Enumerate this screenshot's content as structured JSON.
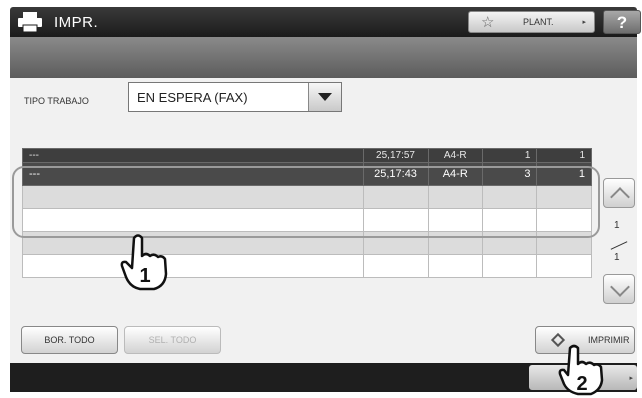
{
  "title": "IMPR.",
  "toolbar": {
    "template_label": "PLANT.",
    "help_label": "?"
  },
  "filter": {
    "label": "TIPO TRABAJO",
    "value": "EN ESPERA (FAX)"
  },
  "jobs": [
    [
      "---",
      "25,17:57",
      "A4-R",
      "1",
      "1"
    ],
    [
      "---",
      "25,17:43",
      "A4-R",
      "3",
      "1"
    ]
  ],
  "pagination": {
    "current": "1",
    "total": "1"
  },
  "actions": {
    "delete_all": "BOR. TODO",
    "select_all": "SEL. TODO",
    "print": "IMPRIMIR"
  },
  "callouts": [
    "1",
    "2"
  ]
}
